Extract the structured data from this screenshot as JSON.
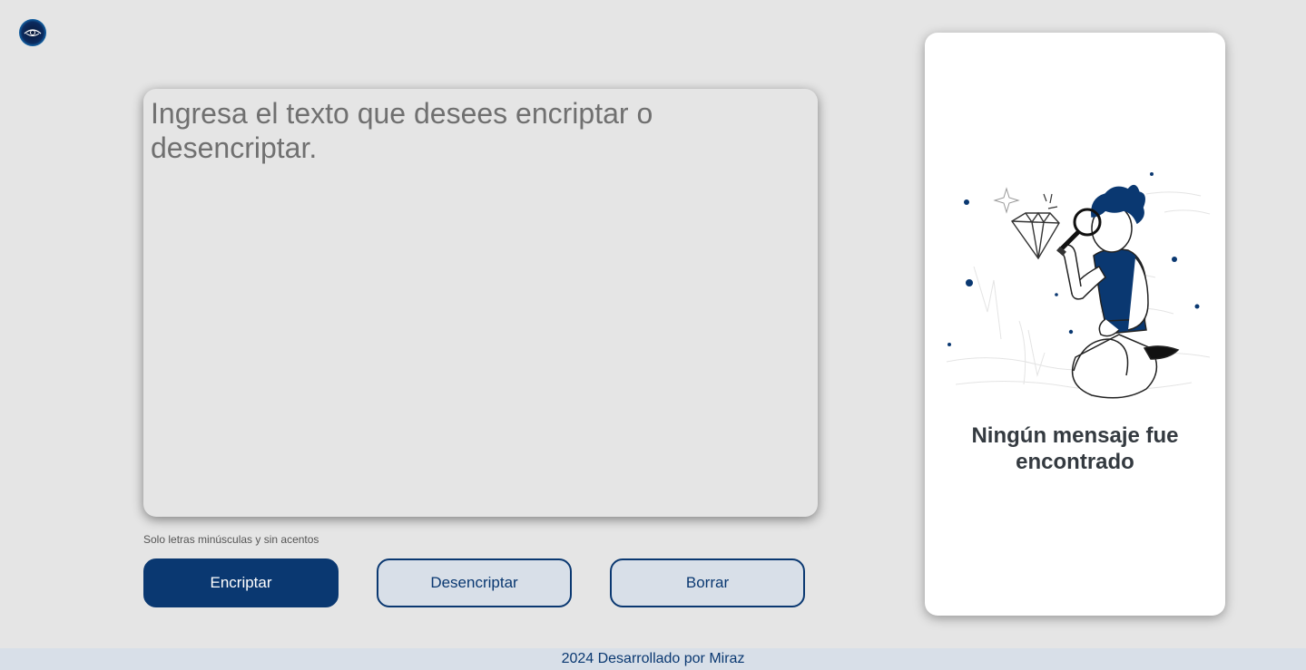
{
  "logo": {
    "icon": "eye-logo-icon",
    "colors": [
      "#0b2a5e",
      "#1a8ad6",
      "#2ee58a"
    ]
  },
  "input": {
    "placeholder": "Ingresa el texto que desees encriptar o desencriptar.",
    "value": ""
  },
  "hint": {
    "text": "Solo letras minúsculas y sin acentos"
  },
  "buttons": {
    "encrypt": "Encriptar",
    "decrypt": "Desencriptar",
    "clear": "Borrar"
  },
  "result": {
    "illustration_icon": "searching-person-illustration",
    "title": "Ningún mensaje fue encontrado"
  },
  "footer": {
    "text": "2024 Desarrollado por Miraz"
  },
  "colors": {
    "accent": "#0a3871",
    "background": "#e5e5e5",
    "secondary_button": "#d8dfe8",
    "card": "#ffffff"
  }
}
